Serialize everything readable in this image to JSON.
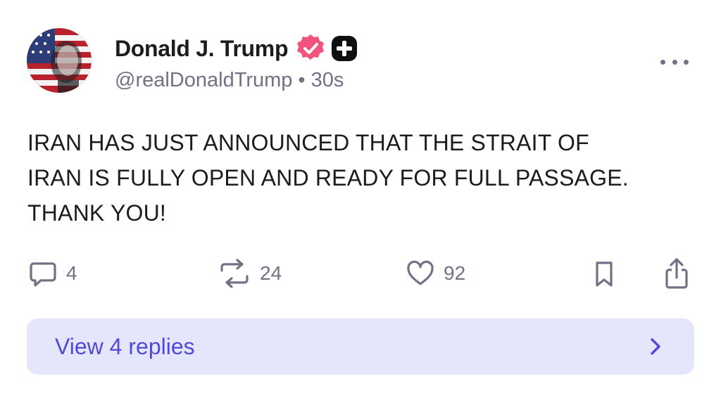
{
  "author": {
    "display_name": "Donald J. Trump",
    "handle": "@realDonaldTrump",
    "separator": "•",
    "time_ago": "30s",
    "avatar_icon": "flag-portrait-avatar",
    "verified_icon": "verified-badge-icon",
    "plus_icon": "plus-badge-icon"
  },
  "post": {
    "lines": [
      "IRAN HAS JUST ANNOUNCED THAT THE STRAIT OF",
      "IRAN IS FULLY OPEN AND READY FOR FULL PASSAGE.",
      "THANK YOU!"
    ]
  },
  "actions": {
    "replies_count": "4",
    "reposts_count": "24",
    "likes_count": "92",
    "bookmark_icon": "bookmark-icon",
    "share_icon": "share-icon"
  },
  "footer": {
    "view_replies_label": "View 4 replies"
  },
  "colors": {
    "text": "#1c1c1f",
    "muted": "#717186",
    "verified": "#f0547c",
    "accent": "#5448d9",
    "replies_bg": "#e4e6fc"
  }
}
